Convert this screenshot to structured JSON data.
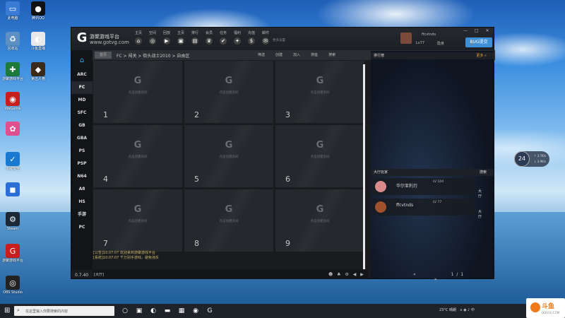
{
  "desktop": {
    "icons": [
      {
        "label": "此电脑",
        "icon": "computer-icon",
        "color": "#3a7bd5",
        "glyph": "▭"
      },
      {
        "label": "腾讯QQ",
        "icon": "qq-icon",
        "color": "#111111",
        "glyph": "●"
      },
      {
        "label": "回收站",
        "icon": "recycle-bin-icon",
        "color": "#5c8fc4",
        "glyph": "♻"
      },
      {
        "label": "斗鱼直播",
        "icon": "douyu-icon",
        "color": "#e8e8e8",
        "glyph": "◐"
      },
      {
        "label": "游聚游戏平台",
        "icon": "gamepad-icon",
        "color": "#1c7a3a",
        "glyph": "✚"
      },
      {
        "label": "第五人格",
        "icon": "game-icon",
        "color": "#3a2a1a",
        "glyph": "◆"
      },
      {
        "label": "WeGame",
        "icon": "wegame-icon",
        "color": "#c81e1e",
        "glyph": "◉"
      },
      {
        "label": "",
        "icon": "photos-icon",
        "color": "#e05090",
        "glyph": "✿"
      },
      {
        "label": "火绒安全",
        "icon": "shield-icon",
        "color": "#1a7ad1",
        "glyph": "✓"
      },
      {
        "label": "",
        "icon": "app-icon",
        "color": "#2b6fd6",
        "glyph": "◼"
      },
      {
        "label": "Steam",
        "icon": "steam-icon",
        "color": "#1b2838",
        "glyph": "⚙"
      },
      {
        "label": "游聚游戏平台",
        "icon": "youju-icon",
        "color": "#c81e1e",
        "glyph": "G"
      },
      {
        "label": "OBS Studio",
        "icon": "obs-icon",
        "color": "#222222",
        "glyph": "◎"
      }
    ]
  },
  "app": {
    "name": "游聚游戏平台",
    "url": "www.gotvg.com",
    "logo_glyph": "G",
    "toolbar": [
      {
        "label": "主页",
        "glyph": "⌂"
      },
      {
        "label": "空间",
        "glyph": "◎"
      },
      {
        "label": "回放",
        "glyph": "▶"
      },
      {
        "label": "主页",
        "glyph": "▣"
      },
      {
        "label": "排行",
        "glyph": "▤"
      },
      {
        "label": "会员",
        "glyph": "♛"
      },
      {
        "label": "任务",
        "glyph": "✔"
      },
      {
        "label": "福利",
        "glyph": "✦"
      },
      {
        "label": "充值",
        "glyph": "$"
      },
      {
        "label": "邮件",
        "glyph": "✉"
      }
    ],
    "toolbar_extra": "更多设置",
    "user": {
      "name": "ffcvtnds",
      "level": "Lv77",
      "status": "隐身"
    },
    "bug_button": "BUG提交",
    "window_controls": "— □ ✕",
    "nav": {
      "home_tab": "首页",
      "breadcrumb": "FC > 闯关 > 街头战士2010 > 自由区",
      "actions": [
        "筛选",
        "创建",
        "加入",
        "排座",
        "搜索"
      ]
    },
    "sidebar": {
      "home_glyph": "⌂",
      "platforms": [
        "ARC",
        "FC",
        "MD",
        "SFC",
        "GB",
        "GBA",
        "PS",
        "PSP",
        "N64",
        "A8",
        "HS",
        "手游",
        "PC"
      ],
      "active": "FC"
    },
    "version": "0.7.40",
    "rooms": {
      "hint": "点击创建房间",
      "glyph": "G",
      "numbers": [
        "1",
        "2",
        "3",
        "4",
        "5",
        "6",
        "7",
        "8",
        "9"
      ]
    },
    "log": [
      "[公告]10:07:07 欢迎来到游聚游戏平台",
      "[系统]10:07:07 千万别手游戏，避免违反"
    ],
    "chat": {
      "label": "[大厅]",
      "icons": "☻ ♣ ⚙ ◀ ▶"
    },
    "right_panel": {
      "ranking_title": "排行榜",
      "ranking_more": "更多 »",
      "lobby_title": "大厅玩家",
      "lobby_search": "搜索",
      "players": [
        {
          "name": "华尔亚利刃",
          "level": "LV 104",
          "badge": "大厅",
          "avatar_color": "#d98a8a"
        },
        {
          "name": "ffcvtnds",
          "level": "LV 77",
          "badge": "大厅",
          "avatar_color": "#a0522d"
        }
      ],
      "pager": {
        "prev": "«",
        "page": "1/1",
        "next": "»"
      }
    }
  },
  "widget": {
    "temp": "24",
    "up": "↑ 3.7K/s",
    "down": "↓ 3.9K/s"
  },
  "taskbar": {
    "start_glyph": "⊞",
    "search_placeholder": "在这里输入你要搜索的内容",
    "search_glyph": "⌕",
    "apps": [
      {
        "name": "cortana-icon",
        "glyph": "○"
      },
      {
        "name": "task-view-icon",
        "glyph": "▣"
      },
      {
        "name": "edge-icon",
        "glyph": "◐"
      },
      {
        "name": "explorer-icon",
        "glyph": "▬"
      },
      {
        "name": "store-icon",
        "glyph": "▦"
      },
      {
        "name": "steam-taskbar-icon",
        "glyph": "◉"
      },
      {
        "name": "youju-taskbar-icon",
        "glyph": "G"
      }
    ],
    "weather": "23°C 晴朗",
    "tray_icons": "∧ ◉ ♪ 中"
  },
  "watermark": {
    "name": "斗鱼",
    "domain": "DOUYU.COM"
  }
}
